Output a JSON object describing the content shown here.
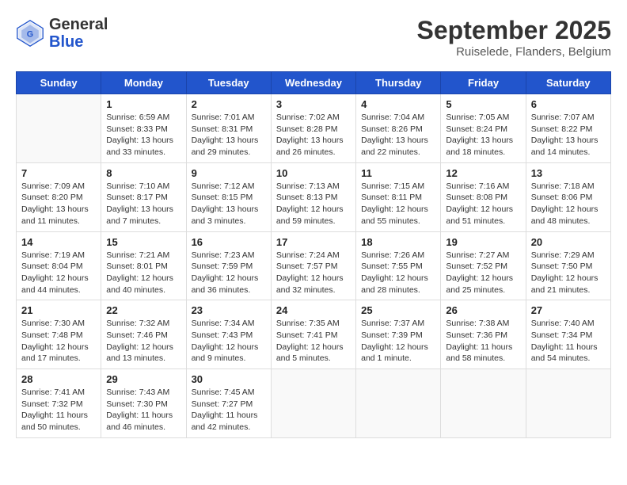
{
  "header": {
    "logo_general": "General",
    "logo_blue": "Blue",
    "title": "September 2025",
    "location": "Ruiselede, Flanders, Belgium"
  },
  "weekdays": [
    "Sunday",
    "Monday",
    "Tuesday",
    "Wednesday",
    "Thursday",
    "Friday",
    "Saturday"
  ],
  "weeks": [
    [
      {
        "day": "",
        "sunrise": "",
        "sunset": "",
        "daylight": ""
      },
      {
        "day": "1",
        "sunrise": "Sunrise: 6:59 AM",
        "sunset": "Sunset: 8:33 PM",
        "daylight": "Daylight: 13 hours and 33 minutes."
      },
      {
        "day": "2",
        "sunrise": "Sunrise: 7:01 AM",
        "sunset": "Sunset: 8:31 PM",
        "daylight": "Daylight: 13 hours and 29 minutes."
      },
      {
        "day": "3",
        "sunrise": "Sunrise: 7:02 AM",
        "sunset": "Sunset: 8:28 PM",
        "daylight": "Daylight: 13 hours and 26 minutes."
      },
      {
        "day": "4",
        "sunrise": "Sunrise: 7:04 AM",
        "sunset": "Sunset: 8:26 PM",
        "daylight": "Daylight: 13 hours and 22 minutes."
      },
      {
        "day": "5",
        "sunrise": "Sunrise: 7:05 AM",
        "sunset": "Sunset: 8:24 PM",
        "daylight": "Daylight: 13 hours and 18 minutes."
      },
      {
        "day": "6",
        "sunrise": "Sunrise: 7:07 AM",
        "sunset": "Sunset: 8:22 PM",
        "daylight": "Daylight: 13 hours and 14 minutes."
      }
    ],
    [
      {
        "day": "7",
        "sunrise": "Sunrise: 7:09 AM",
        "sunset": "Sunset: 8:20 PM",
        "daylight": "Daylight: 13 hours and 11 minutes."
      },
      {
        "day": "8",
        "sunrise": "Sunrise: 7:10 AM",
        "sunset": "Sunset: 8:17 PM",
        "daylight": "Daylight: 13 hours and 7 minutes."
      },
      {
        "day": "9",
        "sunrise": "Sunrise: 7:12 AM",
        "sunset": "Sunset: 8:15 PM",
        "daylight": "Daylight: 13 hours and 3 minutes."
      },
      {
        "day": "10",
        "sunrise": "Sunrise: 7:13 AM",
        "sunset": "Sunset: 8:13 PM",
        "daylight": "Daylight: 12 hours and 59 minutes."
      },
      {
        "day": "11",
        "sunrise": "Sunrise: 7:15 AM",
        "sunset": "Sunset: 8:11 PM",
        "daylight": "Daylight: 12 hours and 55 minutes."
      },
      {
        "day": "12",
        "sunrise": "Sunrise: 7:16 AM",
        "sunset": "Sunset: 8:08 PM",
        "daylight": "Daylight: 12 hours and 51 minutes."
      },
      {
        "day": "13",
        "sunrise": "Sunrise: 7:18 AM",
        "sunset": "Sunset: 8:06 PM",
        "daylight": "Daylight: 12 hours and 48 minutes."
      }
    ],
    [
      {
        "day": "14",
        "sunrise": "Sunrise: 7:19 AM",
        "sunset": "Sunset: 8:04 PM",
        "daylight": "Daylight: 12 hours and 44 minutes."
      },
      {
        "day": "15",
        "sunrise": "Sunrise: 7:21 AM",
        "sunset": "Sunset: 8:01 PM",
        "daylight": "Daylight: 12 hours and 40 minutes."
      },
      {
        "day": "16",
        "sunrise": "Sunrise: 7:23 AM",
        "sunset": "Sunset: 7:59 PM",
        "daylight": "Daylight: 12 hours and 36 minutes."
      },
      {
        "day": "17",
        "sunrise": "Sunrise: 7:24 AM",
        "sunset": "Sunset: 7:57 PM",
        "daylight": "Daylight: 12 hours and 32 minutes."
      },
      {
        "day": "18",
        "sunrise": "Sunrise: 7:26 AM",
        "sunset": "Sunset: 7:55 PM",
        "daylight": "Daylight: 12 hours and 28 minutes."
      },
      {
        "day": "19",
        "sunrise": "Sunrise: 7:27 AM",
        "sunset": "Sunset: 7:52 PM",
        "daylight": "Daylight: 12 hours and 25 minutes."
      },
      {
        "day": "20",
        "sunrise": "Sunrise: 7:29 AM",
        "sunset": "Sunset: 7:50 PM",
        "daylight": "Daylight: 12 hours and 21 minutes."
      }
    ],
    [
      {
        "day": "21",
        "sunrise": "Sunrise: 7:30 AM",
        "sunset": "Sunset: 7:48 PM",
        "daylight": "Daylight: 12 hours and 17 minutes."
      },
      {
        "day": "22",
        "sunrise": "Sunrise: 7:32 AM",
        "sunset": "Sunset: 7:46 PM",
        "daylight": "Daylight: 12 hours and 13 minutes."
      },
      {
        "day": "23",
        "sunrise": "Sunrise: 7:34 AM",
        "sunset": "Sunset: 7:43 PM",
        "daylight": "Daylight: 12 hours and 9 minutes."
      },
      {
        "day": "24",
        "sunrise": "Sunrise: 7:35 AM",
        "sunset": "Sunset: 7:41 PM",
        "daylight": "Daylight: 12 hours and 5 minutes."
      },
      {
        "day": "25",
        "sunrise": "Sunrise: 7:37 AM",
        "sunset": "Sunset: 7:39 PM",
        "daylight": "Daylight: 12 hours and 1 minute."
      },
      {
        "day": "26",
        "sunrise": "Sunrise: 7:38 AM",
        "sunset": "Sunset: 7:36 PM",
        "daylight": "Daylight: 11 hours and 58 minutes."
      },
      {
        "day": "27",
        "sunrise": "Sunrise: 7:40 AM",
        "sunset": "Sunset: 7:34 PM",
        "daylight": "Daylight: 11 hours and 54 minutes."
      }
    ],
    [
      {
        "day": "28",
        "sunrise": "Sunrise: 7:41 AM",
        "sunset": "Sunset: 7:32 PM",
        "daylight": "Daylight: 11 hours and 50 minutes."
      },
      {
        "day": "29",
        "sunrise": "Sunrise: 7:43 AM",
        "sunset": "Sunset: 7:30 PM",
        "daylight": "Daylight: 11 hours and 46 minutes."
      },
      {
        "day": "30",
        "sunrise": "Sunrise: 7:45 AM",
        "sunset": "Sunset: 7:27 PM",
        "daylight": "Daylight: 11 hours and 42 minutes."
      },
      {
        "day": "",
        "sunrise": "",
        "sunset": "",
        "daylight": ""
      },
      {
        "day": "",
        "sunrise": "",
        "sunset": "",
        "daylight": ""
      },
      {
        "day": "",
        "sunrise": "",
        "sunset": "",
        "daylight": ""
      },
      {
        "day": "",
        "sunrise": "",
        "sunset": "",
        "daylight": ""
      }
    ]
  ]
}
